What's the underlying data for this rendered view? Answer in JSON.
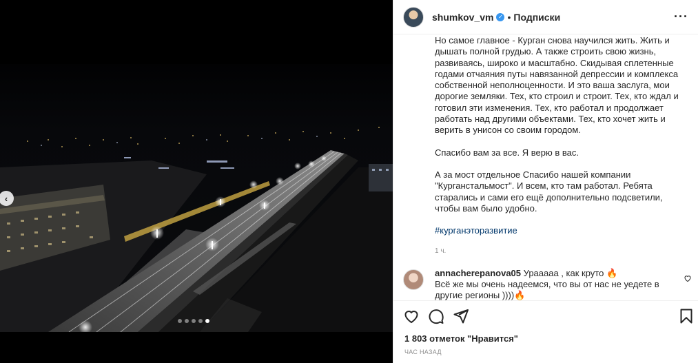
{
  "post": {
    "username": "shumkov_vm",
    "verified_mark": "✓",
    "separator": "•",
    "follow_label": "Подписки",
    "more_label": "···",
    "caption_paragraphs": [
      "Но самое главное - Курган снова научился жить. Жить и дышать полной грудью. А также строить свою жизнь, развиваясь, широко и масштабно. Скидывая сплетенные годами отчаяния путы навязанной депрессии и комплекса собственной неполноценности. И это ваша заслуга, мои дорогие земляки. Тех, кто строил и строит. Тех, кто ждал и готовил эти изменения. Тех, кто работал и продолжает работать над другими объектами. Тех, кто хочет жить и верить в унисон со своим городом.",
      "Спасибо вам за все. Я верю в вас.",
      "А за мост отдельное Спасибо нашей компании \"Курганстальмост\". И всем, кто там работал. Ребята старались и сами его ещё дополнительно подсветили, чтобы вам было удобно."
    ],
    "hashtag": "#курганэторазвитие",
    "time_posted": "1 ч.",
    "likes_text": "1 803 отметок \"Нравится\"",
    "posted_ago": "ЧАС НАЗАД"
  },
  "comment": {
    "username": "annacherepanova05",
    "text": "Урааааа , как круто 🔥",
    "text_line2": "Всё же мы очень надеемся, что вы от нас не уедете в",
    "text_line3": "другие регионы ))))🔥"
  },
  "carousel": {
    "prev_icon": "‹",
    "slide_count": 5,
    "active_slide": 5
  },
  "colors": {
    "hashtag": "#00376b",
    "verified": "#3897f0",
    "muted": "#8e8e8e"
  }
}
